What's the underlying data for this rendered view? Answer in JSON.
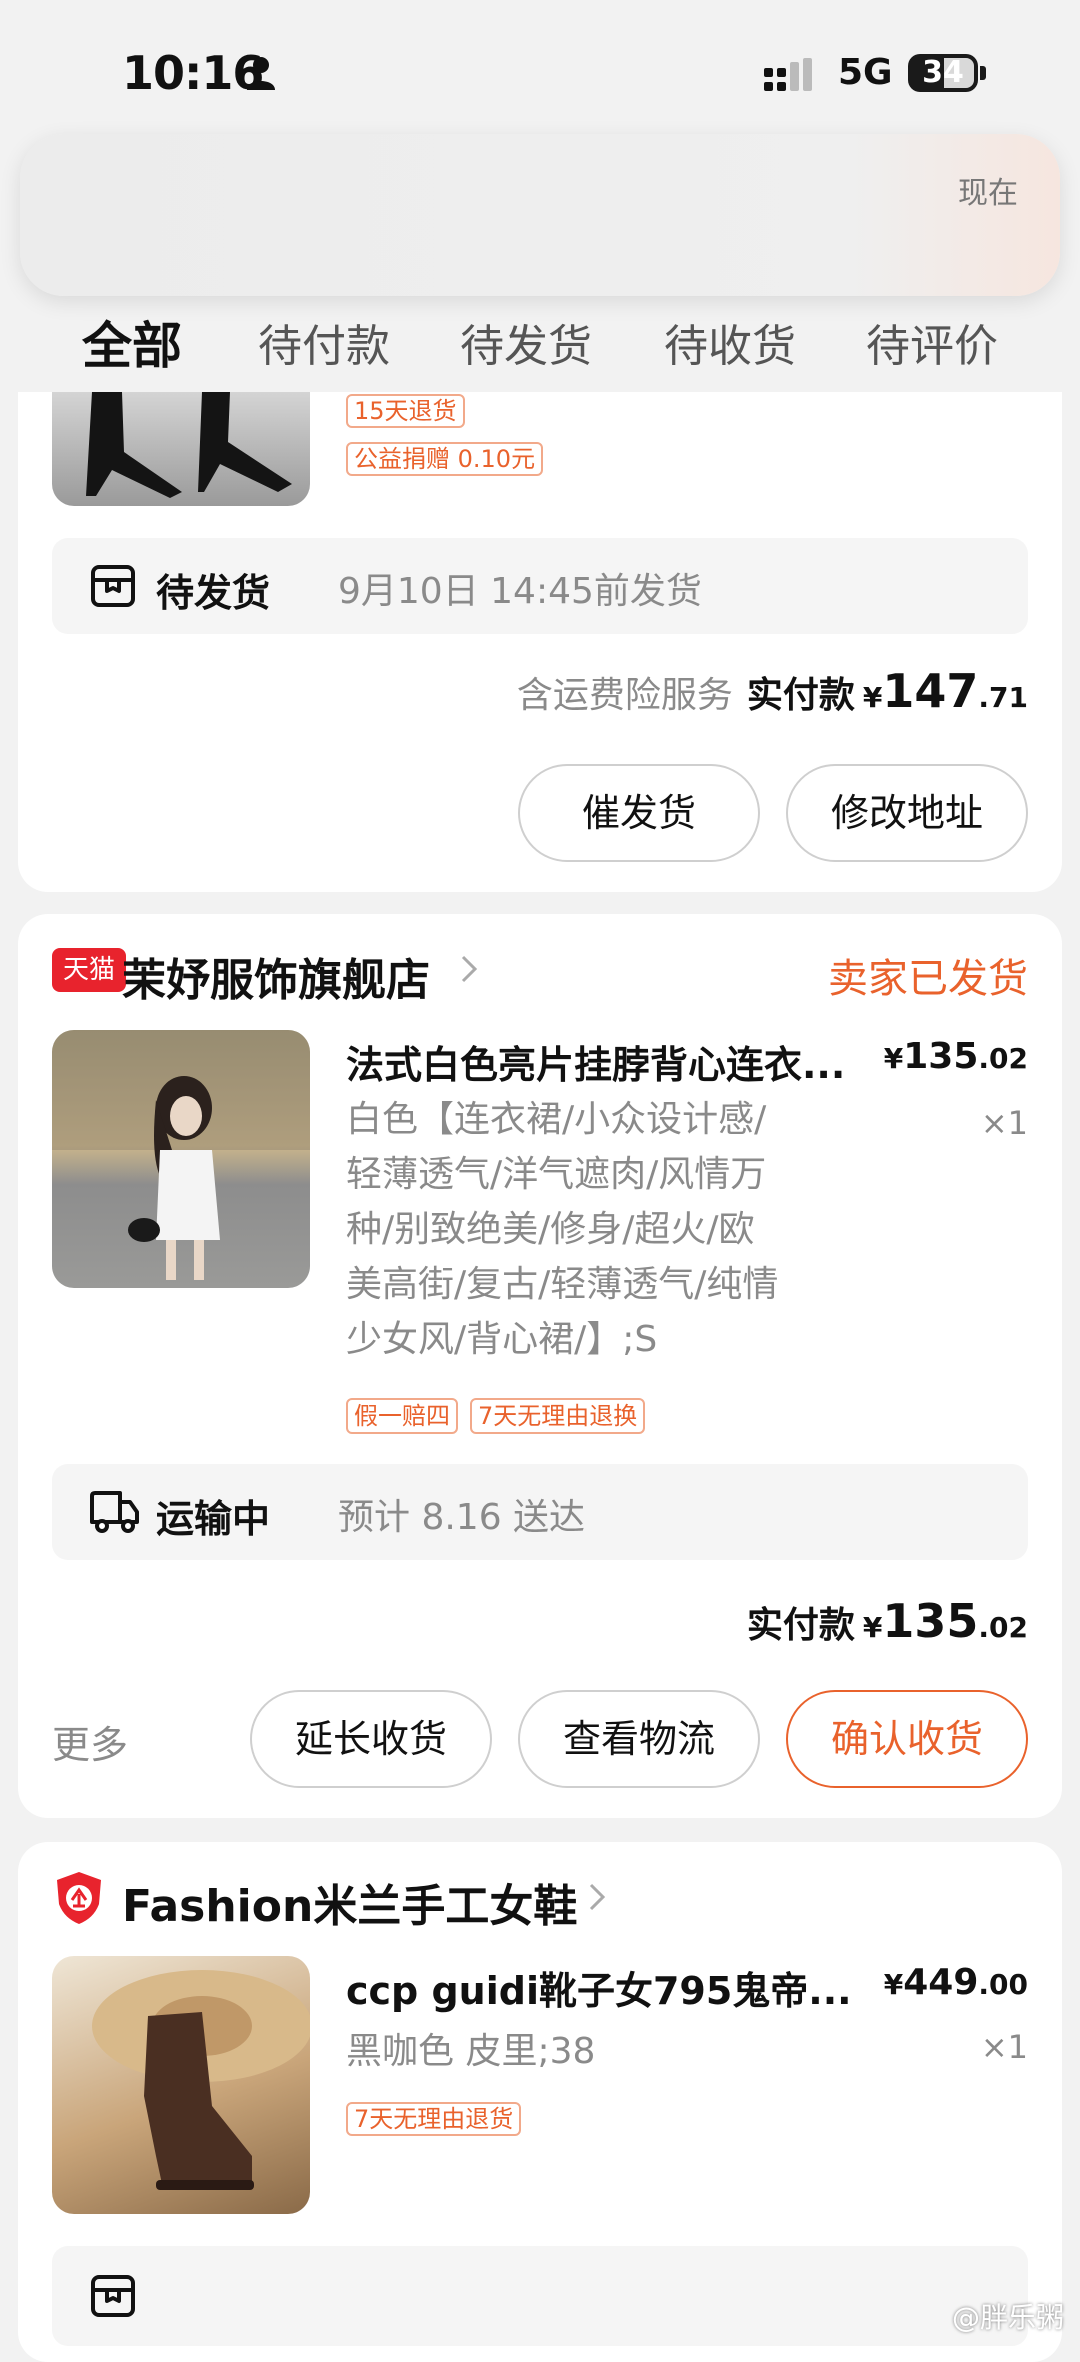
{
  "status": {
    "time": "10:16",
    "network": "5G",
    "battery": "34"
  },
  "notification": {
    "time": "现在"
  },
  "tabs": [
    "全部",
    "待付款",
    "待发货",
    "待收货",
    "待评价"
  ],
  "order1": {
    "tags": [
      "15天退货",
      "公益捐赠 0.10元"
    ],
    "status_label": "待发货",
    "status_detail": "9月10日 14:45前发货",
    "insurance_note": "含运费险服务",
    "paid_label": "实付款",
    "currency": "¥",
    "total_int": "147",
    "total_dec": ".71",
    "buttons": [
      "催发货",
      "修改地址"
    ]
  },
  "order2": {
    "store_badge": "天猫",
    "store_name": "茉妤服饰旗舰店",
    "shipping_status": "卖家已发货",
    "product_title": "法式白色亮片挂脖背心连衣...",
    "price_currency": "¥",
    "price_int": "135",
    "price_dec": ".02",
    "spec_lines": [
      "白色【连衣裙/小众设计感/",
      "轻薄透气/洋气遮肉/风情万",
      "种/别致绝美/修身/超火/欧",
      "美高街/复古/轻薄透气/纯情",
      "少女风/背心裙/】;S"
    ],
    "quantity": "×1",
    "tags": [
      "假一赔四",
      "7天无理由退换"
    ],
    "logistics_label": "运输中",
    "logistics_detail": "预计 8.16 送达",
    "paid_label": "实付款",
    "currency": "¥",
    "total_int": "135",
    "total_dec": ".02",
    "more_label": "更多",
    "buttons": [
      "延长收货",
      "查看物流",
      "确认收货"
    ]
  },
  "order3": {
    "store_name": "Fashion米兰手工女鞋",
    "product_title": "ccp guidi靴子女795鬼帝...",
    "price_currency": "¥",
    "price_int": "449",
    "price_dec": ".00",
    "spec": "黑咖色 皮里;38",
    "quantity": "×1",
    "tags": [
      "7天无理由退货"
    ]
  },
  "watermark": "@胖乐粥",
  "colors": {
    "accent": "#e9622c",
    "tmall_red": "#e8232d",
    "background": "#f2f2f2"
  }
}
